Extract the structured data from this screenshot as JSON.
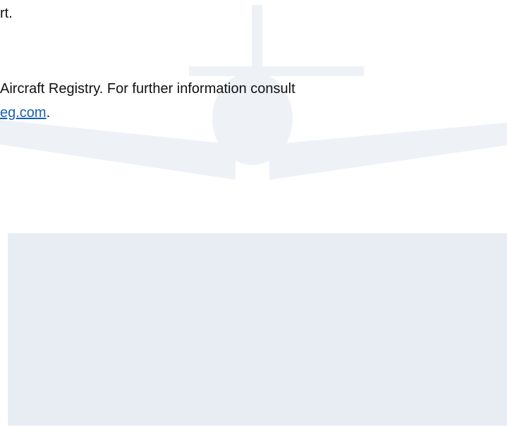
{
  "colors": {
    "page_background": "#ffffff",
    "text": "#111111",
    "link": "#1a5fb4",
    "watermark": "#eef2f7",
    "panel": "#e8edf4"
  },
  "watermark": {
    "icon": "airplane-icon"
  },
  "text": {
    "line1": "rt.",
    "line2": "Aircraft Registry. For further information consult",
    "link_text": "eg.com",
    "line3_suffix": "."
  },
  "panel": {
    "state": "empty"
  }
}
